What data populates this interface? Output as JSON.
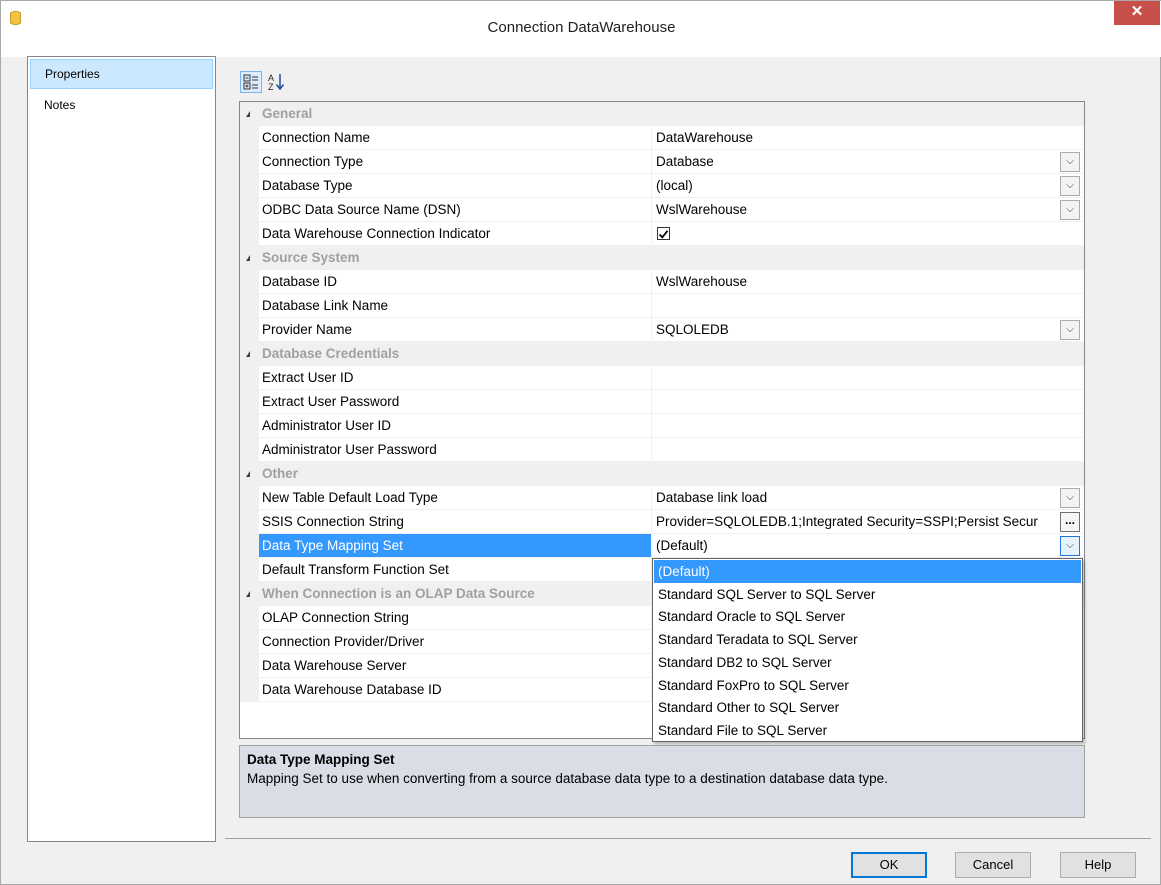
{
  "window": {
    "title": "Connection DataWarehouse",
    "close": "✕"
  },
  "nav": {
    "items": [
      {
        "label": "Properties"
      },
      {
        "label": "Notes"
      }
    ]
  },
  "toolbar": {
    "categorized": "categorized-view-icon",
    "alphabetical": "sort-alphabetical-icon"
  },
  "grid": {
    "rows": [
      {
        "type": "category",
        "label": "General"
      },
      {
        "type": "prop",
        "name": "Connection Name",
        "value": "DataWarehouse"
      },
      {
        "type": "prop",
        "name": "Connection Type",
        "value": "Database",
        "dropdown": true
      },
      {
        "type": "prop",
        "name": "Database Type",
        "value": "(local)",
        "dropdown": true
      },
      {
        "type": "prop",
        "name": "ODBC Data Source Name (DSN)",
        "value": "WslWarehouse",
        "dropdown": true
      },
      {
        "type": "prop",
        "name": "Data Warehouse Connection Indicator",
        "value": "",
        "checkbox": true
      },
      {
        "type": "category",
        "label": "Source System"
      },
      {
        "type": "prop",
        "name": "Database ID",
        "value": "WslWarehouse"
      },
      {
        "type": "prop",
        "name": "Database Link Name",
        "value": ""
      },
      {
        "type": "prop",
        "name": "Provider Name",
        "value": "SQLOLEDB",
        "dropdown": true
      },
      {
        "type": "category",
        "label": "Database Credentials"
      },
      {
        "type": "prop",
        "name": "Extract User ID",
        "value": ""
      },
      {
        "type": "prop",
        "name": "Extract User Password",
        "value": ""
      },
      {
        "type": "prop",
        "name": "Administrator User ID",
        "value": ""
      },
      {
        "type": "prop",
        "name": "Administrator User Password",
        "value": ""
      },
      {
        "type": "category",
        "label": "Other"
      },
      {
        "type": "prop",
        "name": "New Table Default Load Type",
        "value": "Database link load",
        "dropdown": true
      },
      {
        "type": "prop",
        "name": "SSIS Connection String",
        "value": "Provider=SQLOLEDB.1;Integrated Security=SSPI;Persist Secur",
        "ellipsis": "..."
      },
      {
        "type": "prop",
        "name": "Data Type Mapping Set",
        "value": "(Default)",
        "dropdown": true,
        "selected": true
      },
      {
        "type": "prop",
        "name": "Default Transform Function Set",
        "value": ""
      },
      {
        "type": "category",
        "label": "When Connection is an OLAP Data Source"
      },
      {
        "type": "prop",
        "name": "OLAP Connection String",
        "value": ""
      },
      {
        "type": "prop",
        "name": "Connection Provider/Driver",
        "value": ""
      },
      {
        "type": "prop",
        "name": "Data Warehouse Server",
        "value": ""
      },
      {
        "type": "prop",
        "name": "Data Warehouse Database ID",
        "value": ""
      }
    ]
  },
  "dropdown": {
    "options": [
      "(Default)",
      "Standard SQL Server to SQL Server",
      "Standard Oracle to SQL Server",
      "Standard Teradata to SQL Server",
      "Standard DB2 to SQL Server",
      "Standard FoxPro to SQL Server",
      "Standard Other to SQL Server",
      "Standard File to SQL Server"
    ],
    "highlighted": 0
  },
  "description": {
    "title": "Data Type Mapping Set",
    "text": "Mapping Set to use when converting from a source database data type to a destination database data type."
  },
  "buttons": {
    "ok": "OK",
    "cancel": "Cancel",
    "help": "Help"
  }
}
